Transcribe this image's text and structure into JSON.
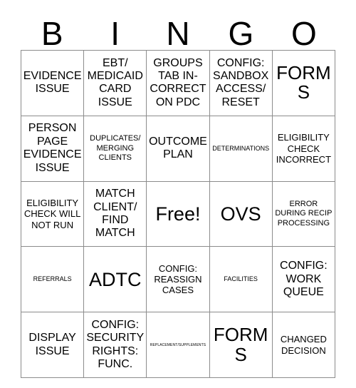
{
  "header": {
    "letters": [
      "B",
      "I",
      "N",
      "G",
      "O"
    ]
  },
  "grid": {
    "rows": 5,
    "columns": 5,
    "cells": [
      [
        {
          "text": "EVIDENCE ISSUE",
          "size": "md"
        },
        {
          "text": "EBT/ MEDICAID CARD ISSUE",
          "size": "md"
        },
        {
          "text": "GROUPS TAB IN-CORRECT ON PDC",
          "size": "md"
        },
        {
          "text": "CONFIG: SANDBOX ACCESS/ RESET",
          "size": "md"
        },
        {
          "text": "FORMS",
          "size": "lg"
        }
      ],
      [
        {
          "text": "PERSON PAGE EVIDENCE ISSUE",
          "size": "md"
        },
        {
          "text": "DUPLICATES/ MERGING CLIENTS",
          "size": "xs"
        },
        {
          "text": "OUTCOME PLAN",
          "size": "md"
        },
        {
          "text": "DETERMINATIONS",
          "size": "tiny"
        },
        {
          "text": "ELIGIBILITY CHECK INCORRECT",
          "size": "sm"
        }
      ],
      [
        {
          "text": "ELIGIBILITY CHECK WILL NOT RUN",
          "size": "sm"
        },
        {
          "text": "MATCH CLIENT/ FIND MATCH",
          "size": "md"
        },
        {
          "text": "Free!",
          "size": "xl"
        },
        {
          "text": "OVS",
          "size": "xl"
        },
        {
          "text": "ERROR DURING RECIP PROCESSING",
          "size": "xs"
        }
      ],
      [
        {
          "text": "REFERRALS",
          "size": "tiny"
        },
        {
          "text": "ADTC",
          "size": "xl"
        },
        {
          "text": "CONFIG: REASSIGN CASES",
          "size": "sm"
        },
        {
          "text": "FACILITIES",
          "size": "tiny"
        },
        {
          "text": "CONFIG: WORK QUEUE",
          "size": "md"
        }
      ],
      [
        {
          "text": "DISPLAY ISSUE",
          "size": "md"
        },
        {
          "text": "CONFIG: SECURITY RIGHTS: FUNC.",
          "size": "md"
        },
        {
          "text": "REPLACEMENT/SUPPLEMENTS",
          "size": "micro"
        },
        {
          "text": "FORMS",
          "size": "lg"
        },
        {
          "text": "CHANGED DECISION",
          "size": "sm"
        }
      ]
    ]
  },
  "colors": {
    "background": "#ffffff",
    "text": "#000000",
    "border": "#8c8c8c"
  }
}
